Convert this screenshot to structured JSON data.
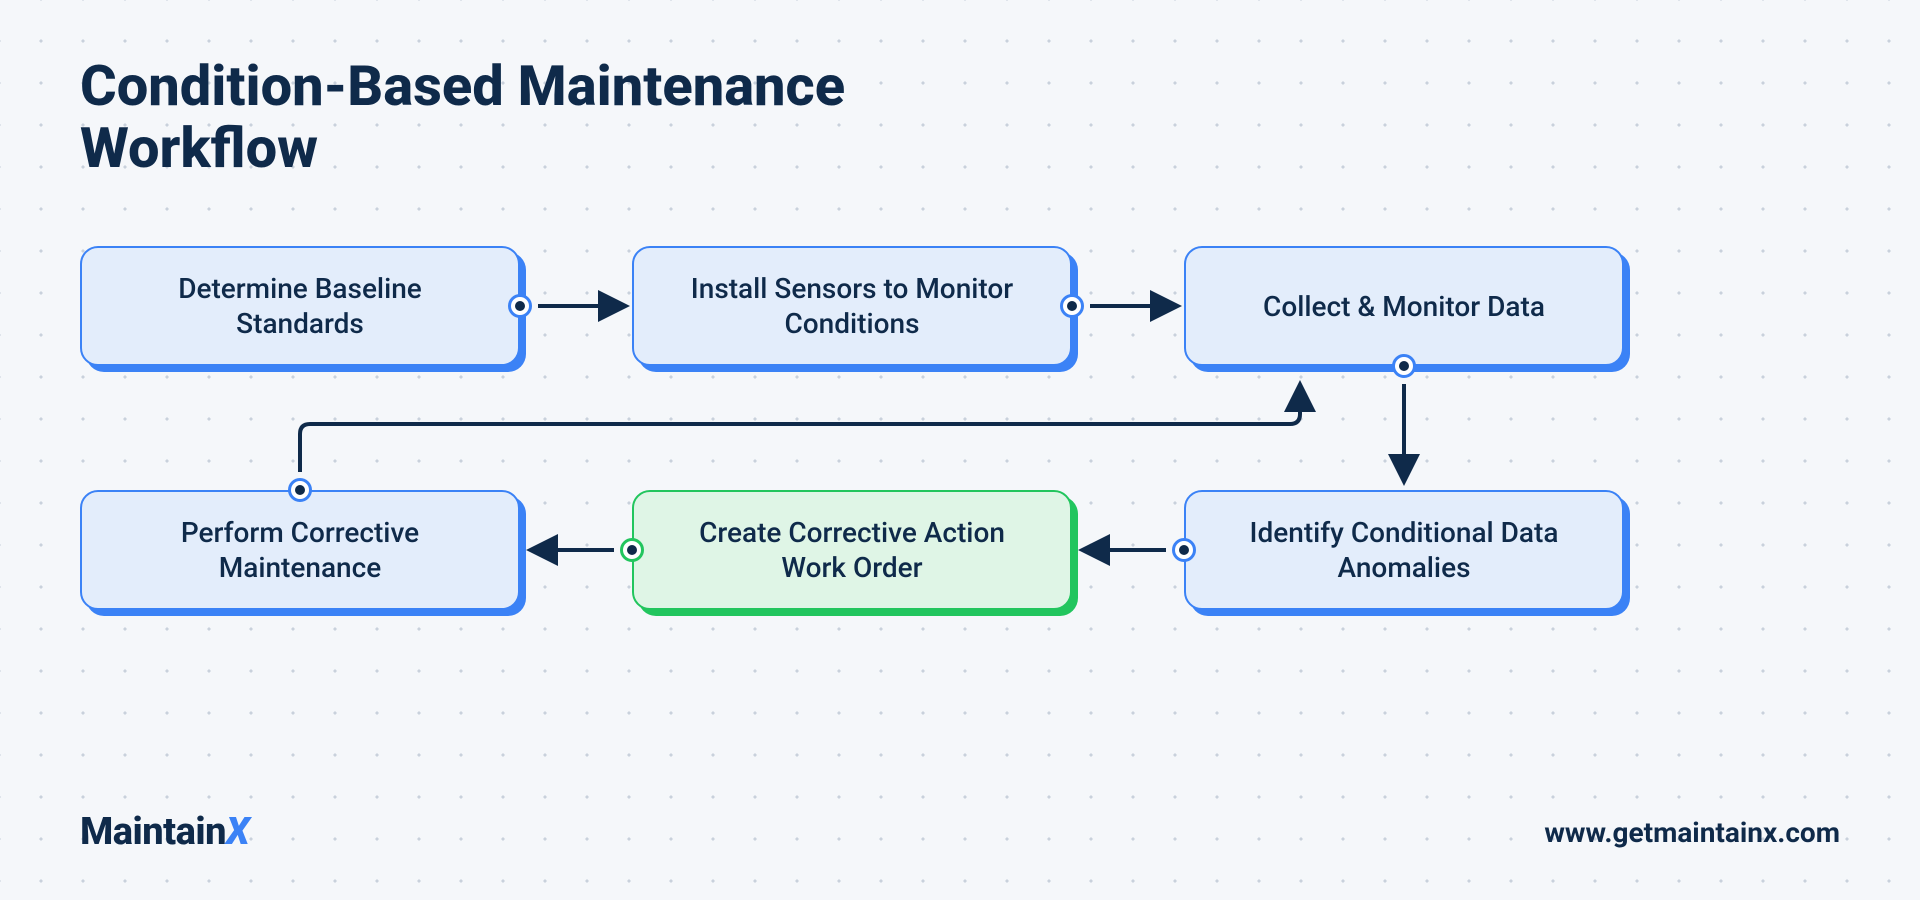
{
  "title": "Condition-Based Maintenance Workflow",
  "boxes": {
    "b1": "Determine Baseline Standards",
    "b2": "Install Sensors to Monitor Conditions",
    "b3": "Collect & Monitor Data",
    "b4": "Identify Conditional Data Anomalies",
    "b5": "Create Corrective Action Work Order",
    "b6": "Perform Corrective Maintenance"
  },
  "logo_main": "Maintain",
  "logo_x": "X",
  "url": "www.getmaintainx.com",
  "colors": {
    "navy": "#0f2a4a",
    "blue": "#3b82f6",
    "green": "#22c55e",
    "bg": "#f5f7fa"
  }
}
